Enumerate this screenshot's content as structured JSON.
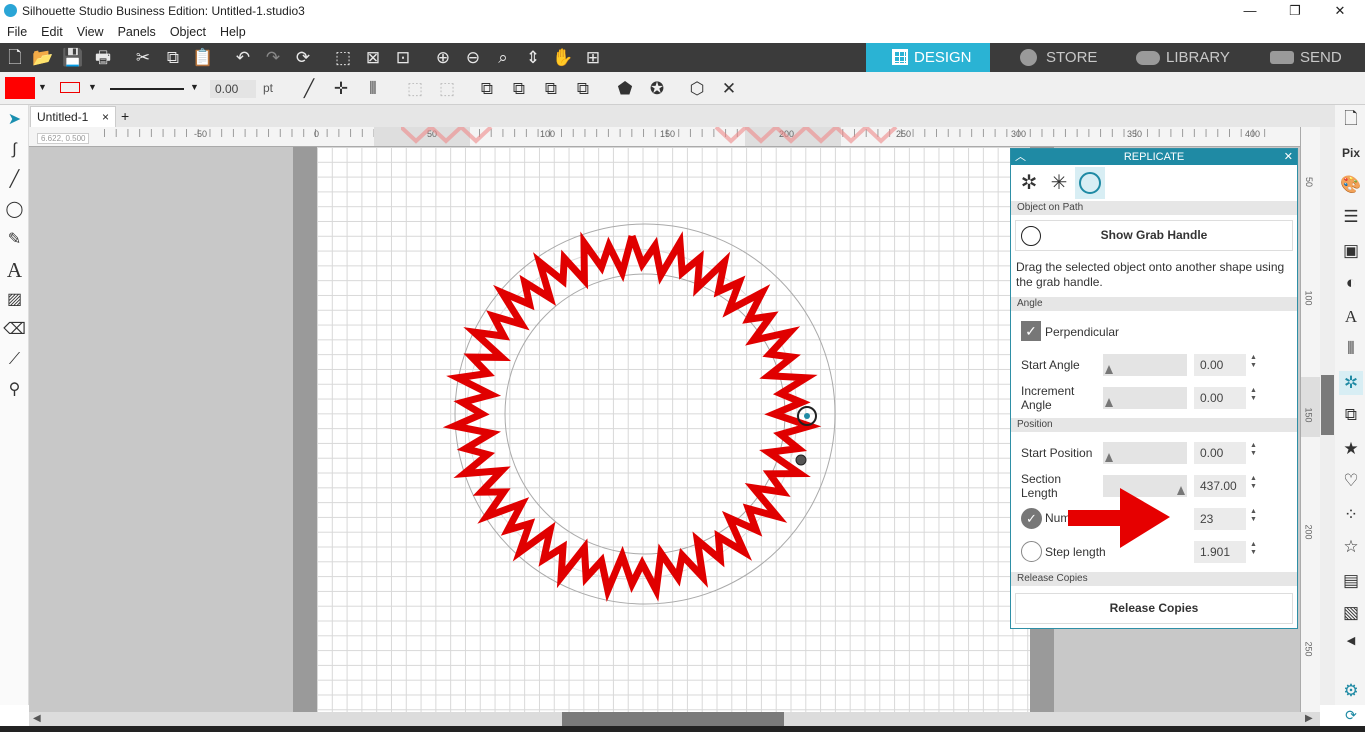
{
  "window": {
    "title": "Silhouette Studio Business Edition: Untitled-1.studio3",
    "min": "—",
    "max": "❐",
    "close": "✕"
  },
  "menu": [
    "File",
    "Edit",
    "View",
    "Panels",
    "Object",
    "Help"
  ],
  "modes": {
    "design": "DESIGN",
    "store": "STORE",
    "library": "LIBRARY",
    "send": "SEND"
  },
  "toolbar2": {
    "line_width": "0.00",
    "unit": "pt"
  },
  "doc_tab": {
    "name": "Untitled-1",
    "close": "×",
    "add": "+"
  },
  "ruler": {
    "coord": "6.622, 0.500",
    "h_ticks": [
      "-50",
      "0",
      "50",
      "100",
      "150",
      "200",
      "250",
      "300",
      "350",
      "400"
    ],
    "v_ticks": [
      "50",
      "100",
      "150",
      "200",
      "250"
    ]
  },
  "panel": {
    "title": "REPLICATE",
    "sections": {
      "object_on_path": "Object on Path",
      "angle": "Angle",
      "position": "Position",
      "release": "Release Copies"
    },
    "show_grab_handle": "Show Grab Handle",
    "description": "Drag the selected object onto another shape using the grab handle.",
    "perpendicular": "Perpendicular",
    "start_angle": {
      "label": "Start Angle",
      "value": "0.00"
    },
    "increment_angle": {
      "label": "Increment Angle",
      "value": "0.00"
    },
    "start_position": {
      "label": "Start Position",
      "value": "0.00"
    },
    "section_length": {
      "label": "Section Length",
      "value": "437.00"
    },
    "number": {
      "label": "Number",
      "value": "23"
    },
    "step_length": {
      "label": "Step length",
      "value": "1.901"
    },
    "release_copies": "Release Copies"
  },
  "colors": {
    "accent": "#2ab3d4",
    "panel_head": "#1f8aa4",
    "shape": "#e00000",
    "arrow": "#e60000"
  }
}
